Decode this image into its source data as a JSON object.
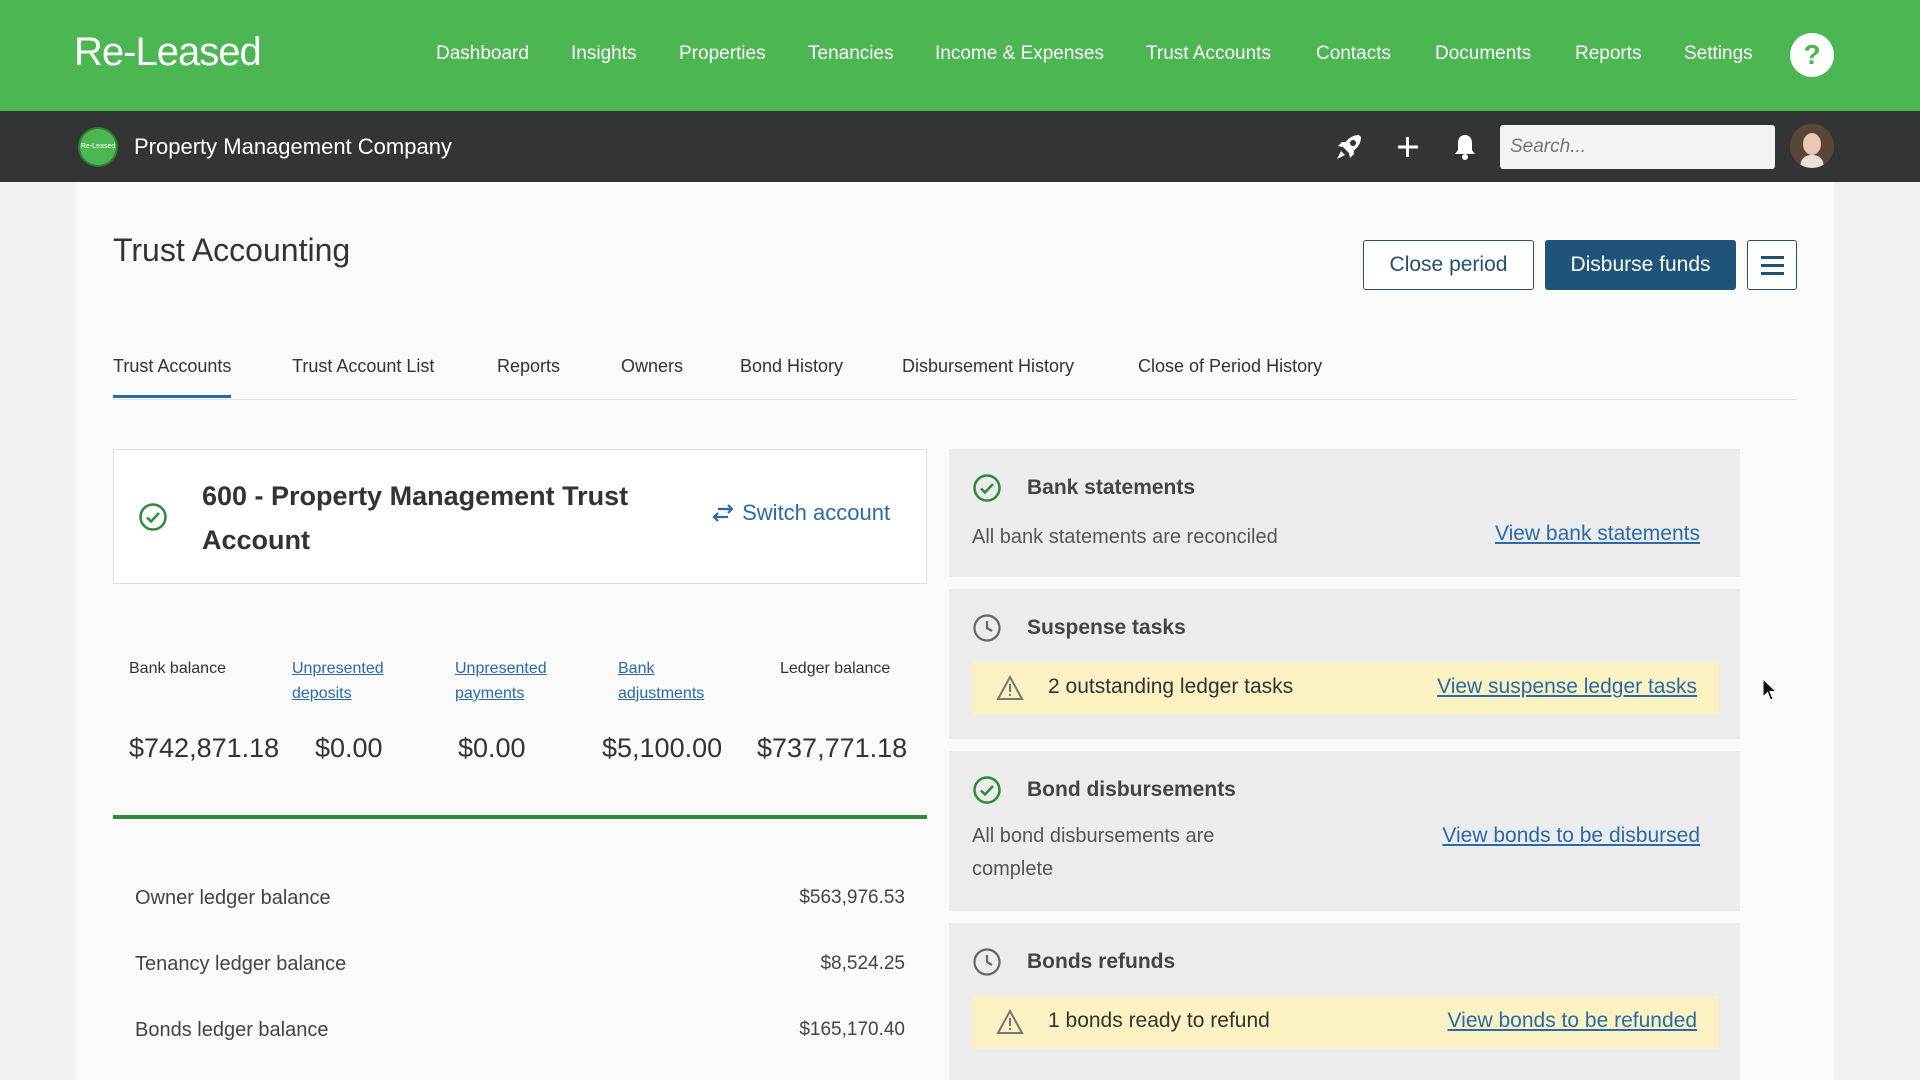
{
  "app": {
    "logo": "Re-Leased",
    "nav": [
      "Dashboard",
      "Insights",
      "Properties",
      "Tenancies",
      "Income & Expenses",
      "Trust Accounts",
      "Contacts",
      "Documents",
      "Reports",
      "Settings"
    ],
    "help": "?"
  },
  "company_bar": {
    "logo_text": "Re-Leased",
    "company": "Property Management Company",
    "search_placeholder": "Search..."
  },
  "page": {
    "title": "Trust Accounting",
    "close_period": "Close period",
    "disburse_funds": "Disburse funds"
  },
  "tabs": [
    "Trust Accounts",
    "Trust Account List",
    "Reports",
    "Owners",
    "Bond History",
    "Disbursement History",
    "Close of Period History"
  ],
  "account": {
    "title": "600 - Property Management Trust Account",
    "switch": "Switch account"
  },
  "balances": {
    "labels": [
      {
        "l1": "Bank balance",
        "l2": ""
      },
      {
        "l1": "Unpresented",
        "l2": "deposits"
      },
      {
        "l1": "Unpresented",
        "l2": "payments"
      },
      {
        "l1": "Bank",
        "l2": "adjustments"
      },
      {
        "l1": "Ledger balance",
        "l2": ""
      }
    ],
    "values": [
      "$742,871.18",
      "$0.00",
      "$0.00",
      "$5,100.00",
      "$737,771.18"
    ]
  },
  "ledgers": [
    {
      "label": "Owner ledger balance",
      "value": "$563,976.53"
    },
    {
      "label": "Tenancy ledger balance",
      "value": "$8,524.25"
    },
    {
      "label": "Bonds ledger balance",
      "value": "$165,170.40"
    }
  ],
  "panels": {
    "bank": {
      "title": "Bank statements",
      "text": "All bank statements are reconciled",
      "link": "View bank statements"
    },
    "suspense": {
      "title": "Suspense tasks",
      "warning": "2 outstanding ledger tasks",
      "link": "View suspense ledger tasks"
    },
    "bond_disb": {
      "title": "Bond disbursements",
      "text1": "All bond disbursements are",
      "text2": "complete",
      "link": "View bonds to be disbursed"
    },
    "bond_ref": {
      "title": "Bonds refunds",
      "warning": "1 bonds ready to refund",
      "link": "View bonds to be refunded"
    }
  },
  "colors": {
    "brand_green": "#4cb652",
    "dark_bar": "#333436",
    "primary_blue": "#1f5378",
    "link_blue": "#2a6aa8",
    "warning_bg": "#fbf2c4",
    "ok_green": "#2e8b3a"
  }
}
